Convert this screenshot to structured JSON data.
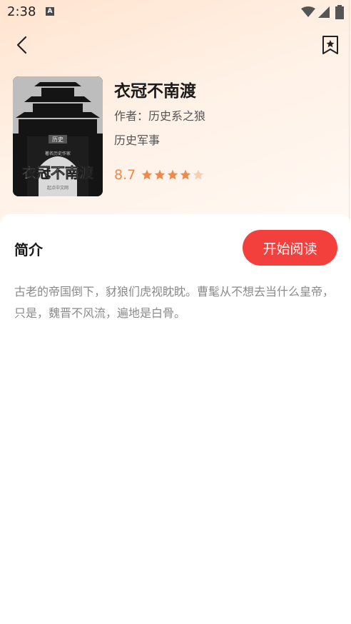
{
  "status_bar": {
    "time": "2:38",
    "notification_icon": "A"
  },
  "nav": {
    "back_icon": "chevron-left-icon",
    "bookmark_icon": "bookmark-star-icon"
  },
  "book": {
    "title": "衣冠不南渡",
    "author": "作者：历史系之狼",
    "category": "历史军事",
    "rating": "8.7",
    "stars_filled": 4,
    "stars_total": 5,
    "cover": {
      "title": "衣冠不南渡",
      "tag_top": "历史",
      "author_small": "著名历史作家",
      "publisher": "起点中文网"
    }
  },
  "intro": {
    "heading": "简介",
    "start_reading_label": "开始阅读",
    "text": "古老的帝国倒下，豺狼们虎视眈眈。曹髦从不想去当什么皇帝，只是，魏晋不风流，遍地是白骨。"
  },
  "colors": {
    "accent": "#f4403d",
    "rating": "#f08a4b"
  }
}
